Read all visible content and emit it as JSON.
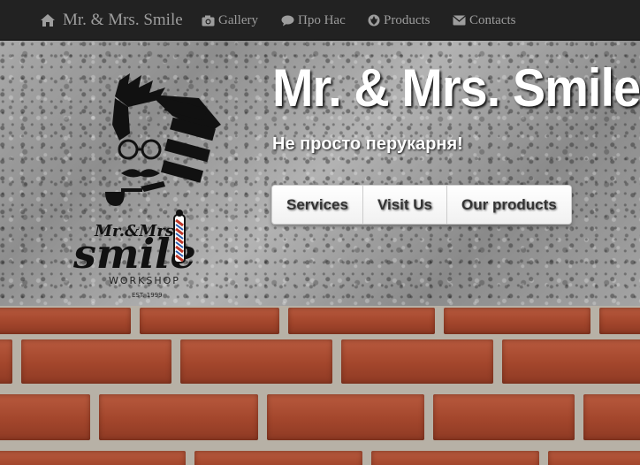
{
  "navbar": {
    "brand": "Mr. & Mrs. Smile",
    "brand_icon": "home-icon",
    "items": [
      {
        "label": "Gallery",
        "icon": "camera-icon"
      },
      {
        "label": "Про Нас",
        "icon": "comment-icon"
      },
      {
        "label": "Products",
        "icon": "rebel-icon"
      },
      {
        "label": "Contacts",
        "icon": "envelope-icon"
      }
    ]
  },
  "hero": {
    "title": "Mr. & Mrs. Smile",
    "subtitle": "Не просто перукарня!",
    "buttons": [
      "Services",
      "Visit Us",
      "Our products"
    ],
    "logo": {
      "script_text": "Mr.&Mrs.",
      "word": "smile",
      "tagline": "WORKSHOP",
      "est": "EST. 1999"
    }
  },
  "colors": {
    "navbar_bg": "#222222",
    "nav_text": "#9d9d9d",
    "hero_text": "#ffffff",
    "brick": "#a3462c"
  }
}
